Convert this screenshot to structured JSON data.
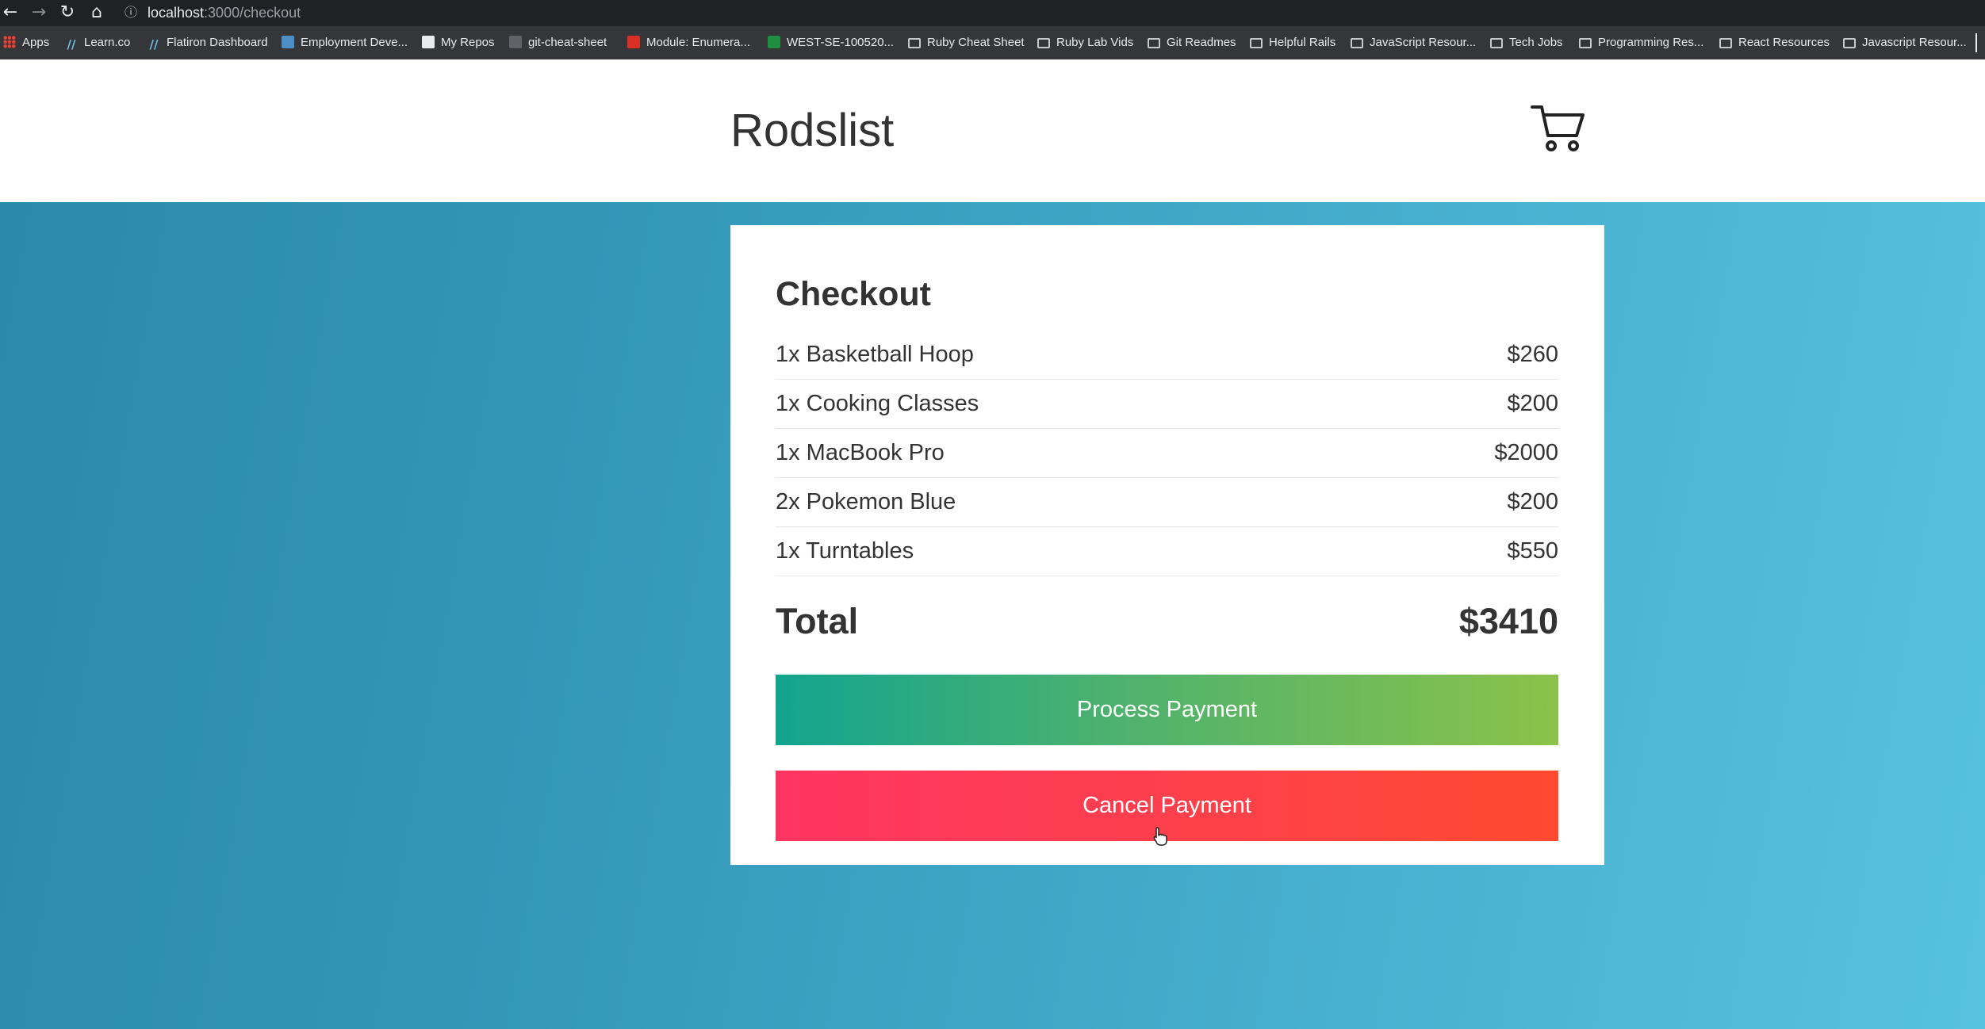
{
  "browser": {
    "url_host": "localhost",
    "url_path": ":3000/checkout",
    "nav": {
      "back": "←",
      "forward": "→",
      "reload": "↻",
      "home": "⌂"
    },
    "bookmarks": [
      {
        "label": "Apps",
        "icon": "apps-grid-icon"
      },
      {
        "label": "Learn.co",
        "icon": "learn-icon"
      },
      {
        "label": "Flatiron Dashboard",
        "icon": "flatiron-icon"
      },
      {
        "label": "Employment Deve...",
        "icon": "edd-icon"
      },
      {
        "label": "My Repos",
        "icon": "github-icon"
      },
      {
        "label": "git-cheat-sheet",
        "icon": "github-icon"
      },
      {
        "label": "Module: Enumera...",
        "icon": "canvas-icon"
      },
      {
        "label": "WEST-SE-100520...",
        "icon": "sheets-icon"
      },
      {
        "label": "Ruby Cheat Sheet",
        "icon": "folder-icon"
      },
      {
        "label": "Ruby Lab Vids",
        "icon": "folder-icon"
      },
      {
        "label": "Git Readmes",
        "icon": "folder-icon"
      },
      {
        "label": "Helpful Rails",
        "icon": "folder-icon"
      },
      {
        "label": "JavaScript Resour...",
        "icon": "folder-icon"
      },
      {
        "label": "Tech Jobs",
        "icon": "folder-icon"
      },
      {
        "label": "Programming Res...",
        "icon": "folder-icon"
      },
      {
        "label": "React Resources",
        "icon": "folder-icon"
      },
      {
        "label": "Javascript Resour...",
        "icon": "folder-icon"
      }
    ]
  },
  "header": {
    "logo": "Rodslist",
    "cart_icon": "shopping-cart-icon"
  },
  "checkout": {
    "title": "Checkout",
    "items": [
      {
        "name": "1x Basketball Hoop",
        "price": "$260"
      },
      {
        "name": "1x Cooking Classes",
        "price": "$200"
      },
      {
        "name": "1x MacBook Pro",
        "price": "$2000"
      },
      {
        "name": "2x Pokemon Blue",
        "price": "$200"
      },
      {
        "name": "1x Turntables",
        "price": "$550"
      }
    ],
    "total_label": "Total",
    "total_value": "$3410",
    "process_label": "Process Payment",
    "cancel_label": "Cancel Payment"
  },
  "colors": {
    "process_gradient": [
      "#12a48f",
      "#8bc24a"
    ],
    "cancel_gradient": [
      "#ff3562",
      "#ff4930"
    ],
    "background_gradient": [
      "#2a8aaa",
      "#56c3de"
    ]
  }
}
